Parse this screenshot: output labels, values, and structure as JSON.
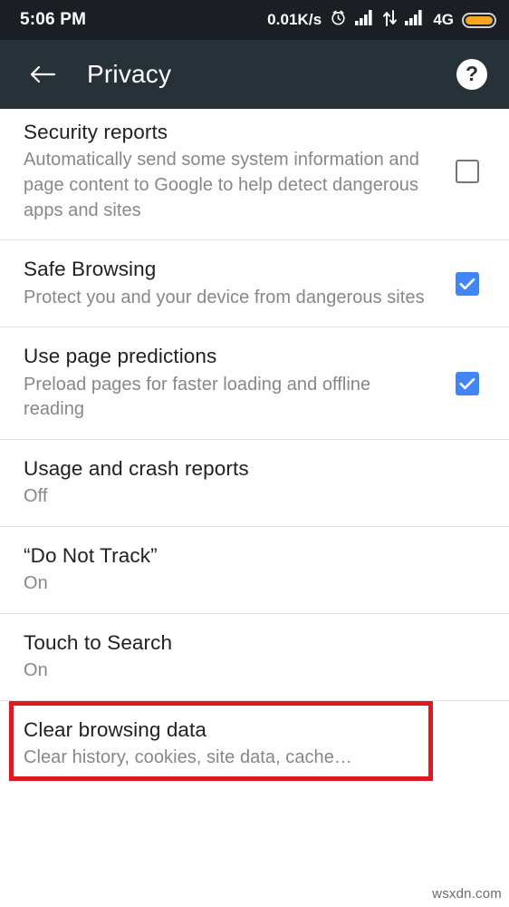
{
  "status_bar": {
    "time": "5:06 PM",
    "network_speed": "0.01K/s",
    "network_type": "4G",
    "icons": [
      "alarm-clock-icon",
      "signal-bars-icon",
      "data-transfer-icon",
      "signal-bars-icon",
      "battery-icon"
    ],
    "background_color": "#1b1f23",
    "battery_color": "#f5a623"
  },
  "toolbar": {
    "title": "Privacy",
    "back_icon": "back-arrow-icon",
    "help_icon": "help-question-icon",
    "help_glyph": "?",
    "background_color": "#273238"
  },
  "settings": {
    "accent_color": "#4285f4",
    "highlight_color": "#e3171e",
    "items": [
      {
        "title": "Security reports",
        "subtitle": "Automatically send some system information and page content to Google to help detect dangerous apps and sites",
        "control": "checkbox",
        "checked": false
      },
      {
        "title": "Safe Browsing",
        "subtitle": "Protect you and your device from dangerous sites",
        "control": "checkbox",
        "checked": true
      },
      {
        "title": "Use page predictions",
        "subtitle": "Preload pages for faster loading and offline reading",
        "control": "checkbox",
        "checked": true
      },
      {
        "title": "Usage and crash reports",
        "subtitle": "Off",
        "control": "none",
        "checked": false
      },
      {
        "title": "“Do Not Track”",
        "subtitle": "On",
        "control": "none",
        "checked": false
      },
      {
        "title": "Touch to Search",
        "subtitle": "On",
        "control": "none",
        "checked": false
      },
      {
        "title": "Clear browsing data",
        "subtitle": "Clear history, cookies, site data, cache…",
        "control": "none",
        "checked": false,
        "highlighted": true
      }
    ]
  },
  "watermark": {
    "text": "wsxdn.com"
  }
}
